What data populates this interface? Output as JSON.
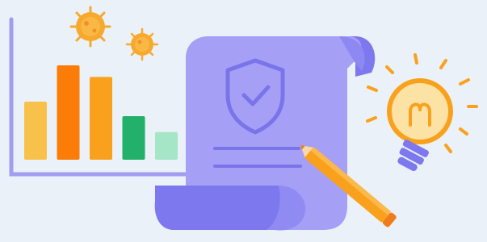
{
  "illustration": {
    "chart": {
      "type": "bar",
      "values": [
        0.4,
        0.65,
        0.57,
        0.3,
        0.19
      ],
      "colors": [
        "#f8c14a",
        "#fb7c06",
        "#f9a11d",
        "#22b06a",
        "#a5e6c6"
      ]
    },
    "icons": [
      "virus-icon",
      "shield-check-icon",
      "document-scroll-icon",
      "pencil-icon",
      "lightbulb-icon"
    ],
    "colors": {
      "background": "#eaf1f8",
      "paper": "#a5a0f5",
      "paper_shadow": "#7d78ee",
      "axis": "#a39cf0",
      "accent_orange": "#f9a11d",
      "virus": "#f7a92d"
    }
  }
}
